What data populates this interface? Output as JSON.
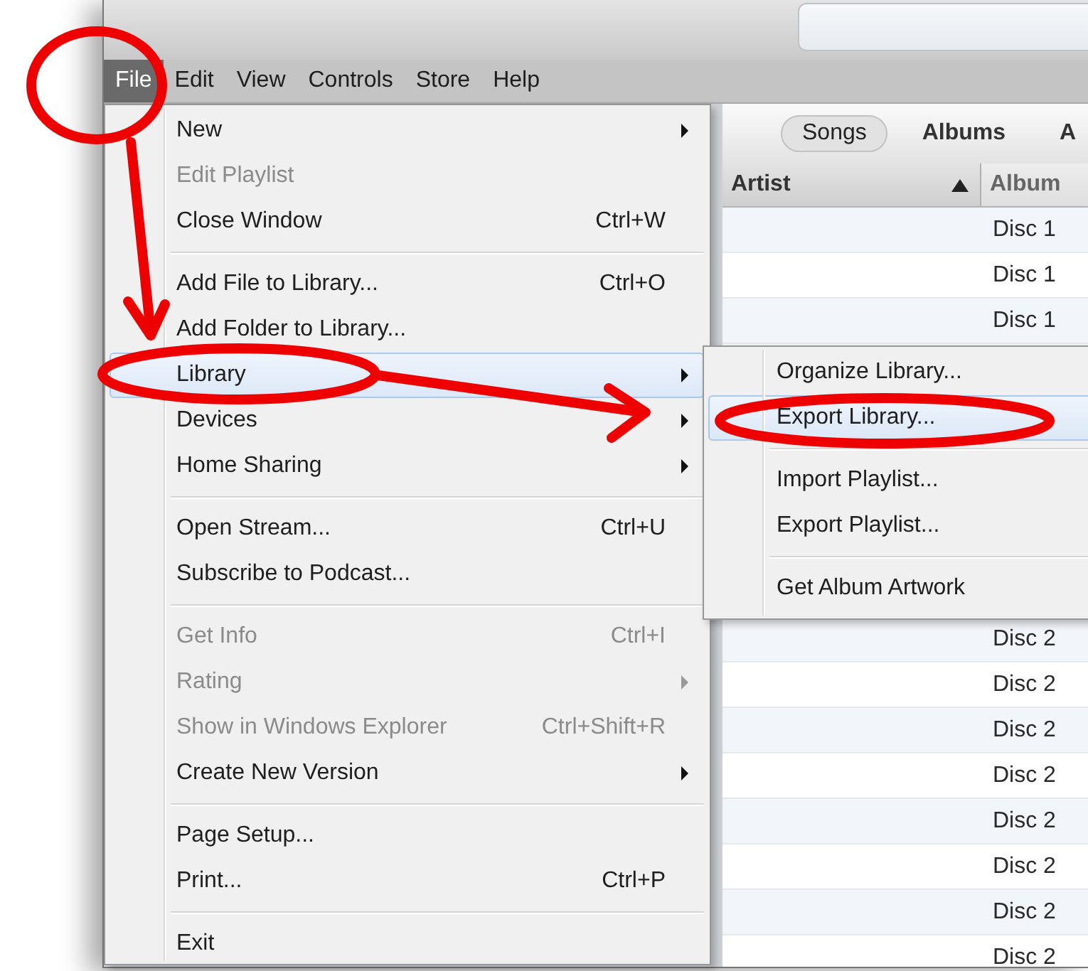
{
  "menu_bar": [
    {
      "label": "File",
      "selected": true
    },
    {
      "label": "Edit",
      "selected": false
    },
    {
      "label": "View",
      "selected": false
    },
    {
      "label": "Controls",
      "selected": false
    },
    {
      "label": "Store",
      "selected": false
    },
    {
      "label": "Help",
      "selected": false
    }
  ],
  "file_menu": {
    "items": [
      {
        "kind": "item",
        "label": "New",
        "submenu": true,
        "disabled": false,
        "selected": false
      },
      {
        "kind": "item",
        "label": "Edit Playlist",
        "disabled": true,
        "selected": false
      },
      {
        "kind": "item",
        "label": "Close Window",
        "shortcut": "Ctrl+W",
        "disabled": false,
        "selected": false
      },
      {
        "kind": "separator"
      },
      {
        "kind": "item",
        "label": "Add File to Library...",
        "shortcut": "Ctrl+O",
        "disabled": false,
        "selected": false
      },
      {
        "kind": "item",
        "label": "Add Folder to Library...",
        "disabled": false,
        "selected": false
      },
      {
        "kind": "item",
        "label": "Library",
        "submenu": true,
        "disabled": false,
        "selected": true
      },
      {
        "kind": "item",
        "label": "Devices",
        "submenu": true,
        "disabled": false,
        "selected": false
      },
      {
        "kind": "item",
        "label": "Home Sharing",
        "submenu": true,
        "disabled": false,
        "selected": false
      },
      {
        "kind": "separator"
      },
      {
        "kind": "item",
        "label": "Open Stream...",
        "shortcut": "Ctrl+U",
        "disabled": false,
        "selected": false
      },
      {
        "kind": "item",
        "label": "Subscribe to Podcast...",
        "disabled": false,
        "selected": false
      },
      {
        "kind": "separator"
      },
      {
        "kind": "item",
        "label": "Get Info",
        "shortcut": "Ctrl+I",
        "disabled": true,
        "selected": false
      },
      {
        "kind": "item",
        "label": "Rating",
        "submenu": true,
        "disabled": true,
        "selected": false
      },
      {
        "kind": "item",
        "label": "Show in Windows Explorer",
        "shortcut": "Ctrl+Shift+R",
        "disabled": true,
        "selected": false
      },
      {
        "kind": "item",
        "label": "Create New Version",
        "submenu": true,
        "disabled": false,
        "selected": false
      },
      {
        "kind": "separator"
      },
      {
        "kind": "item",
        "label": "Page Setup...",
        "disabled": false,
        "selected": false
      },
      {
        "kind": "item",
        "label": "Print...",
        "shortcut": "Ctrl+P",
        "disabled": false,
        "selected": false
      },
      {
        "kind": "separator"
      },
      {
        "kind": "item",
        "label": "Exit",
        "disabled": false,
        "selected": false
      }
    ]
  },
  "library_submenu": {
    "items": [
      {
        "kind": "item",
        "label": "Organize Library...",
        "selected": false
      },
      {
        "kind": "item",
        "label": "Export Library...",
        "selected": true
      },
      {
        "kind": "separator"
      },
      {
        "kind": "item",
        "label": "Import Playlist...",
        "selected": false
      },
      {
        "kind": "item",
        "label": "Export Playlist...",
        "selected": false
      },
      {
        "kind": "separator"
      },
      {
        "kind": "item",
        "label": "Get Album Artwork",
        "selected": false
      }
    ]
  },
  "view_tabs": [
    {
      "label": "Songs",
      "selected": true
    },
    {
      "label": "Albums",
      "selected": false
    },
    {
      "label": "A",
      "selected": false
    }
  ],
  "table": {
    "columns": [
      {
        "label": "Artist",
        "sorted": true
      },
      {
        "label": "Album",
        "sorted": false
      }
    ],
    "row_groups": [
      [
        {
          "album": "Disc 1"
        },
        {
          "album": "Disc 1"
        },
        {
          "album": "Disc 1"
        }
      ],
      [
        {
          "album": "Disc 2"
        },
        {
          "album": "Disc 2"
        },
        {
          "album": "Disc 2"
        },
        {
          "album": "Disc 2"
        },
        {
          "album": "Disc 2"
        },
        {
          "album": "Disc 2"
        },
        {
          "album": "Disc 2"
        },
        {
          "album": "Disc 2"
        }
      ]
    ]
  }
}
